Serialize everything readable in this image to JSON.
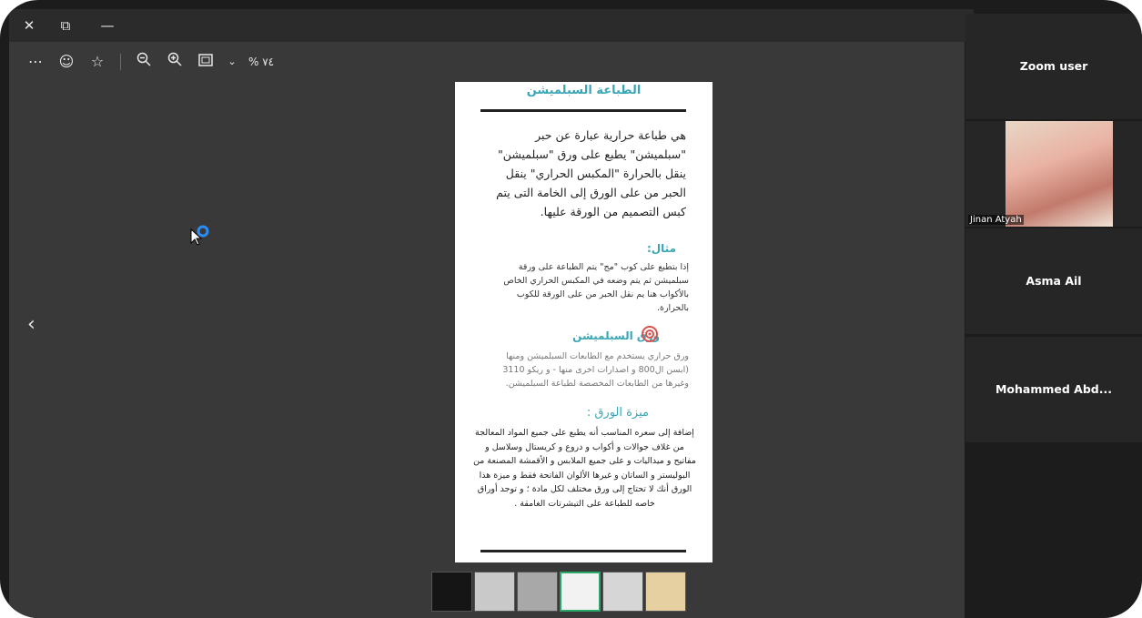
{
  "window": {
    "close_icon": "close-icon",
    "restore_icon": "restore-icon",
    "minimize_icon": "minimize-icon"
  },
  "toolbar": {
    "more_icon": "more-icon",
    "emoji_icon": "smiley-icon",
    "favorite_icon": "star-icon",
    "zoom_out_icon": "zoom-out-icon",
    "zoom_in_icon": "zoom-in-icon",
    "fit_icon": "fit-screen-icon",
    "zoom_level": "% ٧٤"
  },
  "document": {
    "title": "الطباعة السبلميشن",
    "bullet_text": "هي طباعة حرارية عبارة عن حبر \"سبلميشن\" يطبع على ورق \"سبلميشن\" ينقل بالحرارة \"المكبس الحراري\" ينقل الحبر من على الورق إلى الخامة التى يتم كبس التصميم من الورقة عليها.",
    "example_heading": "مثال:",
    "example_text": "إذا بتطبع على كوب \"مج\" يتم الطباعة على ورقة سبلميشن ثم يتم وضعه في المكبس الحراري الخاص بالأكواب هنا يم نقل الحبر من على الورقة للكوب بالحرارة.",
    "paper_heading": "ورق السبلميشن",
    "paper_text": "ورق حراري يستخدم مع الطابعات السبلميشن ومنها (ابسن ال800 و اصدارات اخرى منها - و ريكو 3110 وغيرها من الطابعات المخصصة لطباعة السبلميشن.",
    "feature_heading": "ميزة الورق :",
    "feature_text": "إضافة إلى سعره المناسب أنه يطبع على جميع المواد المعالجة من غلاف جوالات و أكواب و دروع و كريستال وسلاسل و مفاتيح و ميداليات و على جميع الملابس و الأقمشة المصنعة من البوليستر و الساتان و غيرها الألوان الفاتحة فقط و ميزة هذا الورق أنك لا تحتاج إلى ورق مختلف لكل مادة ؛ و توجد أوراق خاصه للطباعة على التيشرتات الغامقة ."
  },
  "navigation": {
    "prev_icon": "chevron-left-icon"
  },
  "thumbnails": {
    "count": 6,
    "selected_index": 3
  },
  "participants": [
    {
      "name": "Zoom user"
    },
    {
      "name": "Jinan Atyah"
    },
    {
      "name": "Asma Ail"
    },
    {
      "name": "Mohammed  Abd..."
    }
  ]
}
